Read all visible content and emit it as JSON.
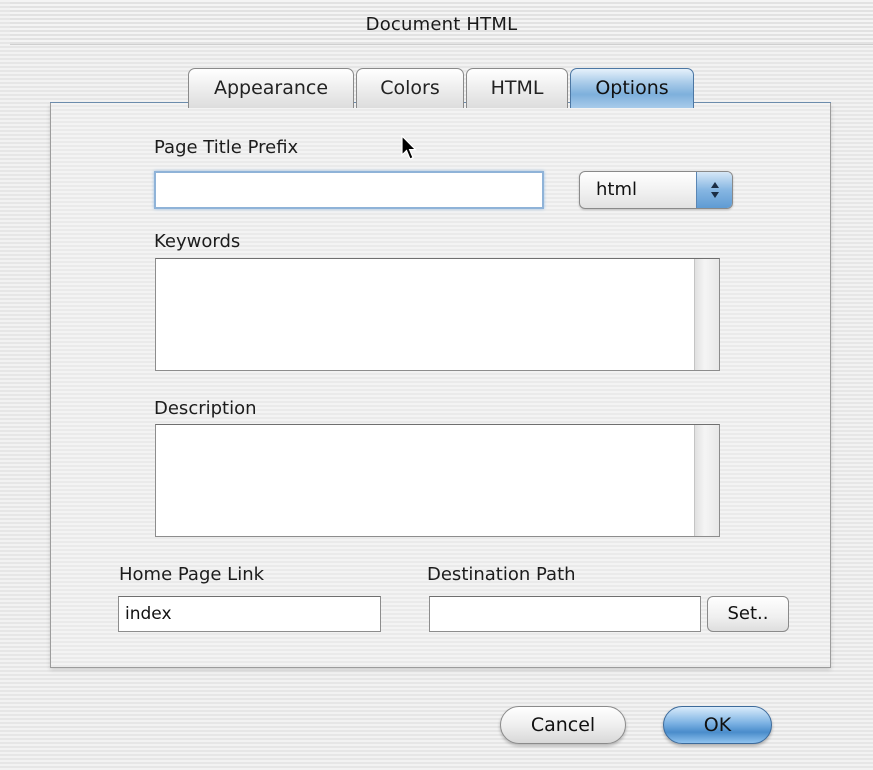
{
  "window": {
    "title": "Document HTML"
  },
  "tabs": [
    {
      "label": "Appearance",
      "active": false
    },
    {
      "label": "Colors",
      "active": false
    },
    {
      "label": "HTML",
      "active": false
    },
    {
      "label": "Options",
      "active": true
    }
  ],
  "options": {
    "page_title_prefix": {
      "label": "Page Title Prefix",
      "value": ""
    },
    "extension_select": {
      "value": "html"
    },
    "keywords": {
      "label": "Keywords",
      "value": ""
    },
    "description": {
      "label": "Description",
      "value": ""
    },
    "home_page_link": {
      "label": "Home Page Link",
      "value": "index"
    },
    "destination_path": {
      "label": "Destination Path",
      "value": ""
    },
    "set_button": "Set.."
  },
  "footer": {
    "cancel_label": "Cancel",
    "ok_label": "OK"
  },
  "colors": {
    "accent": "#7eb0dc",
    "default_button": "#4a8ccb"
  },
  "icons": {
    "pointer": "arrow-cursor-icon",
    "popup": "up-down-arrows-icon"
  }
}
